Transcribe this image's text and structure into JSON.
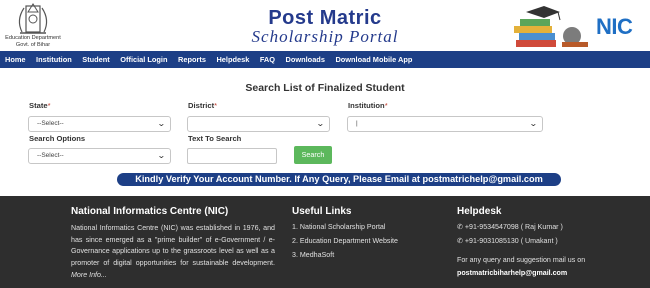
{
  "header": {
    "dept_line1": "Education Department",
    "dept_line2": "Govt. of Bihar",
    "title_main": "Post Matric",
    "title_sub": "Scholarship Portal",
    "nic_logo": "NIC",
    "brand_color": "#243a8c",
    "nav_color": "#1d3f86"
  },
  "nav": {
    "items": [
      "Home",
      "Institution",
      "Student",
      "Official Login",
      "Reports",
      "Helpdesk",
      "FAQ",
      "Downloads",
      "Download Mobile App"
    ]
  },
  "main": {
    "heading": "Search List of Finalized Student",
    "state_label": "State",
    "state_value": "--Select--",
    "district_label": "District",
    "district_value": "",
    "institution_label": "Institution",
    "institution_value": "|",
    "required_mark": "*",
    "search_options_label": "Search Options",
    "search_options_value": "--Select--",
    "text_to_search_label": "Text To Search",
    "text_to_search_value": "",
    "search_button": "Search",
    "search_button_color": "#5cb85c",
    "notice": "Kindly Verify Your Account Number. If Any Query, Please Email at postmatrichelp@gmail.com"
  },
  "footer": {
    "nic_heading": "National Informatics Centre (NIC)",
    "nic_text": "National Informatics Centre (NIC) was established in 1976, and has since emerged as a \"prime builder\" of e-Government / e-Governance applications up to the grassroots level as well as a promoter of digital opportunities for sustainable development.",
    "nic_more": "More Info...",
    "links_heading": "Useful Links",
    "links": [
      "1. National Scholarship Portal",
      "2. Education Department Website",
      "3. MedhaSoft"
    ],
    "help_heading": "Helpdesk",
    "phone_icon": "phone-icon",
    "phones": [
      "+91-9534547098 ( Raj Kumar )",
      "+91-9031085130 ( Umakant )"
    ],
    "help_note": "For any query and suggestion mail us on",
    "help_email": "postmatricbiharhelp@gmail.com",
    "bg_color": "#2e2e2e"
  }
}
